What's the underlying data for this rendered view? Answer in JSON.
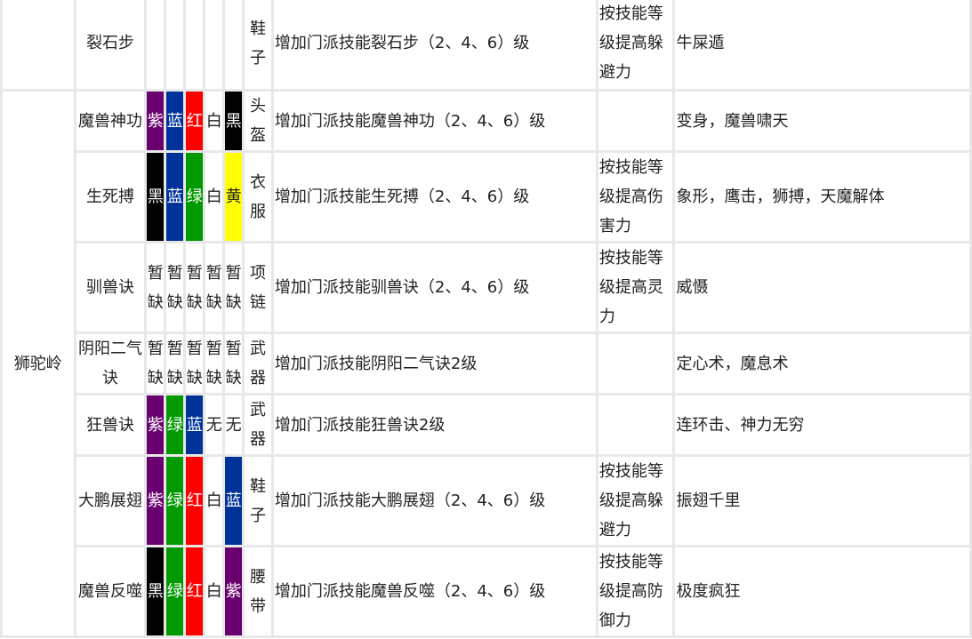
{
  "colors": {
    "紫": "#6a006f",
    "蓝": "#003399",
    "红": "#ff0000",
    "绿": "#009900",
    "黑": "#000000",
    "黄": "#ffff00",
    "白": "#ffffff"
  },
  "sect": "狮驼岭",
  "rows": [
    {
      "skill": "裂石步",
      "stones": [
        "",
        "",
        "",
        "",
        ""
      ],
      "slot": "鞋子",
      "effect": "增加门派技能裂石步（2、4、6）级",
      "bonus": "按技能等级提高躲避力",
      "special": "牛屎遁"
    },
    {
      "skill": "魔兽神功",
      "stones": [
        "紫",
        "蓝",
        "红",
        "白",
        "黑"
      ],
      "slot": "头盔",
      "effect": "增加门派技能魔兽神功（2、4、6）级",
      "bonus": "",
      "special": "变身，魔兽啸天"
    },
    {
      "skill": "生死搏",
      "stones": [
        "黑",
        "蓝",
        "绿",
        "白",
        "黄"
      ],
      "slot": "衣服",
      "effect": "增加门派技能生死搏（2、4、6）级",
      "bonus": "按技能等级提高伤害力",
      "special": "象形，鹰击，狮搏，天魔解体"
    },
    {
      "skill": "驯兽诀",
      "stones": [
        "暂缺",
        "暂缺",
        "暂缺",
        "暂缺",
        "暂缺"
      ],
      "slot": "项链",
      "effect": "增加门派技能驯兽诀（2、4、6）级",
      "bonus": "按技能等级提高灵力",
      "special": "威慑"
    },
    {
      "skill": "阴阳二气诀",
      "stones": [
        "暂缺",
        "暂缺",
        "暂缺",
        "暂缺",
        "暂缺"
      ],
      "slot": "武器",
      "effect": "增加门派技能阴阳二气诀2级",
      "bonus": "",
      "special": "定心术，魔息术"
    },
    {
      "skill": "狂兽诀",
      "stones": [
        "紫",
        "绿",
        "蓝",
        "无",
        "无"
      ],
      "slot": "武器",
      "effect": "增加门派技能狂兽诀2级",
      "bonus": "",
      "special": "连环击、神力无穷"
    },
    {
      "skill": "大鹏展翅",
      "stones": [
        "紫",
        "绿",
        "红",
        "白",
        "蓝"
      ],
      "slot": "鞋子",
      "effect": "增加门派技能大鹏展翅（2、4、6）级",
      "bonus": "按技能等级提高躲避力",
      "special": "振翅千里"
    },
    {
      "skill": "魔兽反噬",
      "stones": [
        "黑",
        "绿",
        "红",
        "白",
        "紫"
      ],
      "slot": "腰带",
      "effect": "增加门派技能魔兽反噬（2、4、6）级",
      "bonus": "按技能等级提高防御力",
      "special": "极度疯狂"
    }
  ]
}
